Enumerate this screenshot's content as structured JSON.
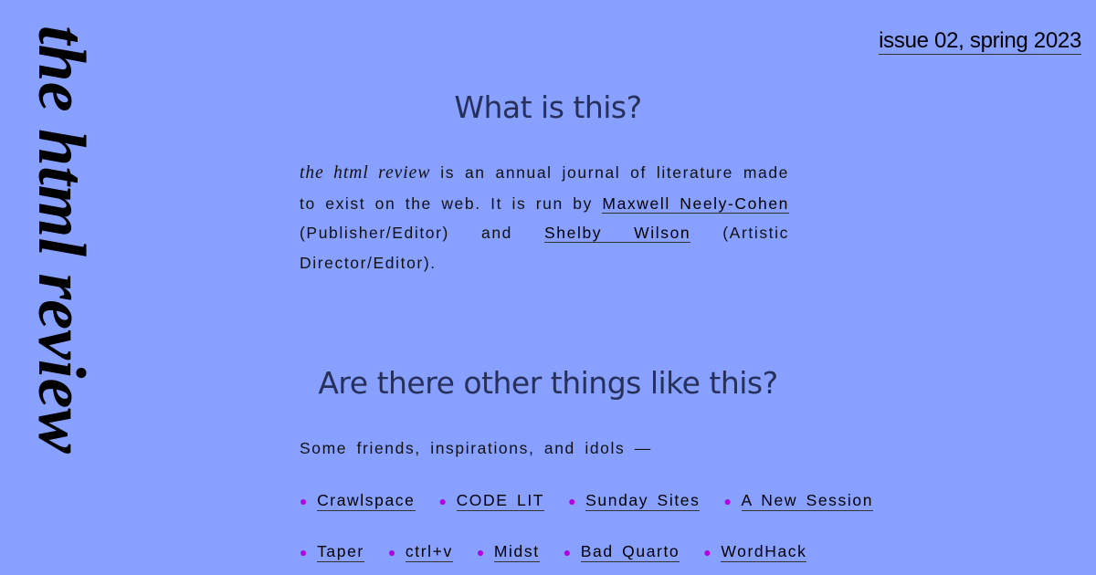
{
  "masthead": {
    "title": "the html review"
  },
  "issue": {
    "label": "issue 02, spring 2023"
  },
  "about": {
    "heading": "What is this?",
    "journal_name": "the html review",
    "text_1": " is an annual journal of literature made to exist on the web. It is run by ",
    "link_publisher": "Maxwell Neely-Cohen",
    "text_2": " (Publisher/Editor) and ",
    "link_artistic": "Shelby Wilson",
    "text_3": " (Artistic Director/Editor)."
  },
  "others": {
    "heading": "Are there other things like this?",
    "intro": "Some friends, inspirations, and idols —",
    "row_1": [
      "Crawlspace",
      "CODE LIT",
      "Sunday Sites",
      "A New Session"
    ],
    "row_2": [
      "Taper",
      "ctrl+v",
      "Midst",
      "Bad Quarto",
      "WordHack"
    ]
  },
  "colors": {
    "background": "#88a0ff",
    "heading": "#26305a",
    "bullet": "#b000e0"
  }
}
